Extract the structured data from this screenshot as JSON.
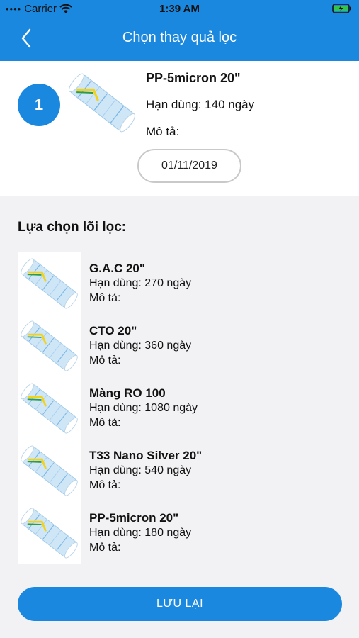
{
  "status_bar": {
    "carrier": "Carrier",
    "time": "1:39 AM",
    "battery_state": "charging"
  },
  "header": {
    "title": "Chọn thay quả lọc"
  },
  "current": {
    "index": "1",
    "name": "PP-5micron 20\"",
    "expiry": "Hạn dùng: 140 ngày",
    "description": "Mô tả:",
    "date": "01/11/2019"
  },
  "selection": {
    "title": "Lựa chọn lõi lọc:",
    "items": [
      {
        "name": "G.A.C 20\"",
        "expiry": "Hạn dùng: 270 ngày",
        "description": "Mô tả:"
      },
      {
        "name": "CTO 20\"",
        "expiry": "Hạn dùng: 360 ngày",
        "description": "Mô tả:"
      },
      {
        "name": "Màng RO 100",
        "expiry": "Hạn dùng: 1080 ngày",
        "description": "Mô tả:"
      },
      {
        "name": "T33 Nano Silver  20\"",
        "expiry": "Hạn dùng: 540 ngày",
        "description": "Mô tả:"
      },
      {
        "name": "PP-5micron 20\"",
        "expiry": "Hạn dùng: 180 ngày",
        "description": "Mô tả:"
      }
    ]
  },
  "save_label": "LƯU LẠI",
  "colors": {
    "primary": "#1a88de",
    "panel": "#f2f2f4"
  }
}
